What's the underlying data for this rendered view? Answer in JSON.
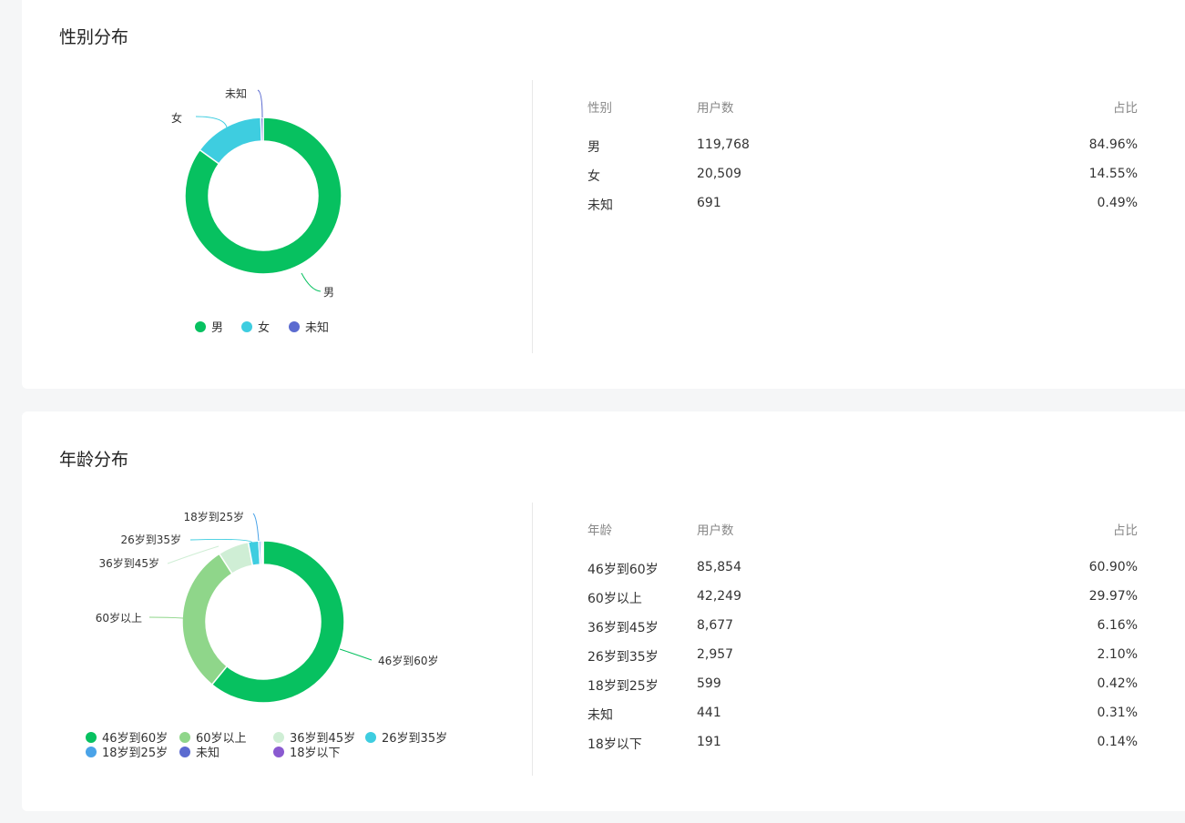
{
  "gender_section": {
    "title": "性别分布",
    "table": {
      "headers": [
        "性别",
        "用户数",
        "占比"
      ],
      "rows": [
        [
          "男",
          "119,768",
          "84.96%"
        ],
        [
          "女",
          "20,509",
          "14.55%"
        ],
        [
          "未知",
          "691",
          "0.49%"
        ]
      ]
    }
  },
  "age_section": {
    "title": "年龄分布",
    "table": {
      "headers": [
        "年龄",
        "用户数",
        "占比"
      ],
      "rows": [
        [
          "46岁到60岁",
          "85,854",
          "60.90%"
        ],
        [
          "60岁以上",
          "42,249",
          "29.97%"
        ],
        [
          "36岁到45岁",
          "8,677",
          "6.16%"
        ],
        [
          "26岁到35岁",
          "2,957",
          "2.10%"
        ],
        [
          "18岁到25岁",
          "599",
          "0.42%"
        ],
        [
          "未知",
          "441",
          "0.31%"
        ],
        [
          "18岁以下",
          "191",
          "0.14%"
        ]
      ]
    }
  },
  "chart_data": [
    {
      "type": "pie",
      "title": "性别分布",
      "categories": [
        "男",
        "女",
        "未知"
      ],
      "values": [
        119768,
        20509,
        691
      ],
      "colors": [
        "#07c160",
        "#3ecde0",
        "#5b6bd0"
      ],
      "legend": "bottom",
      "slice_labels": [
        "男",
        "女",
        "未知"
      ]
    },
    {
      "type": "pie",
      "title": "年龄分布",
      "categories": [
        "46岁到60岁",
        "60岁以上",
        "36岁到45岁",
        "26岁到35岁",
        "18岁到25岁",
        "未知",
        "18岁以下"
      ],
      "values": [
        85854,
        42249,
        8677,
        2957,
        599,
        441,
        191
      ],
      "colors": [
        "#07c160",
        "#8fd68a",
        "#cfeed5",
        "#3ecde0",
        "#4aa3e8",
        "#5b6bd0",
        "#8a5ad0"
      ],
      "legend": "bottom",
      "slice_labels": [
        "46岁到60岁",
        "60岁以上",
        "36岁到45岁",
        "26岁到35岁",
        "18岁到25岁"
      ]
    }
  ]
}
